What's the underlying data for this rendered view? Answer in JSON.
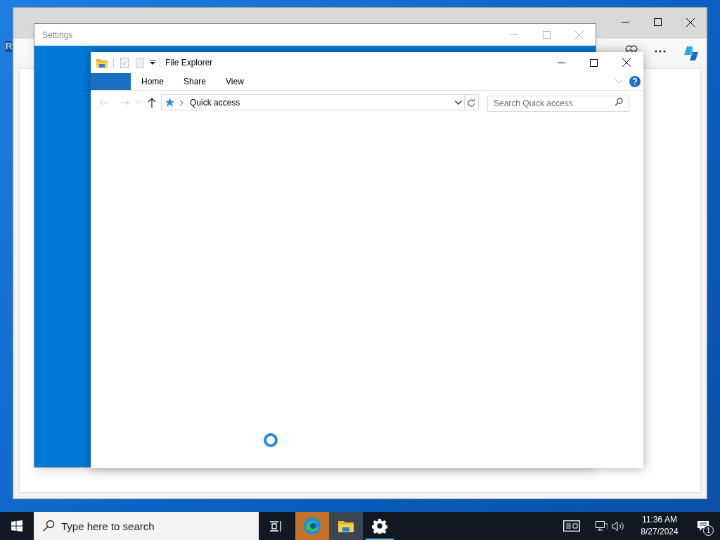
{
  "desktop": {
    "icon_label": "R"
  },
  "settings_window": {
    "title": "Settings"
  },
  "explorer": {
    "title": "File Explorer",
    "ribbon_tabs": [
      {
        "label": "Home",
        "selected": false
      },
      {
        "label": "Share",
        "selected": false
      },
      {
        "label": "View",
        "selected": false
      }
    ],
    "address": "Quick access",
    "search": {
      "placeholder": "Search Quick access"
    },
    "loading": true
  },
  "taskbar": {
    "search": {
      "placeholder": "Type here to search"
    },
    "apps": [
      {
        "kind": "edge",
        "flashing": true,
        "selected": false,
        "running": false
      },
      {
        "kind": "explorer",
        "flashing": false,
        "selected": true,
        "running": false
      },
      {
        "kind": "settings",
        "flashing": false,
        "selected": false,
        "running": true
      }
    ],
    "time": "11:36 AM",
    "date": "8/27/2024",
    "notification_count": "1"
  }
}
